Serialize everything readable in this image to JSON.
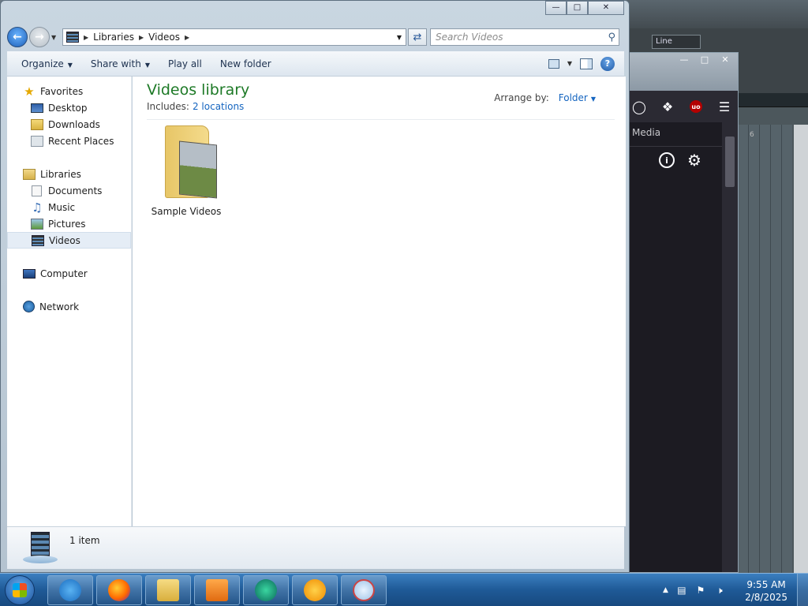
{
  "explorer": {
    "address": {
      "crumbs": [
        "Libraries",
        "Videos"
      ]
    },
    "search": {
      "placeholder": "Search Videos"
    },
    "commands": {
      "organize": "Organize",
      "share_with": "Share with",
      "play_all": "Play all",
      "new_folder": "New folder"
    },
    "nav": {
      "favorites": "Favorites",
      "desktop": "Desktop",
      "downloads": "Downloads",
      "recent_places": "Recent Places",
      "libraries": "Libraries",
      "documents": "Documents",
      "music": "Music",
      "pictures": "Pictures",
      "videos": "Videos",
      "computer": "Computer",
      "network": "Network"
    },
    "library": {
      "title": "Videos library",
      "includes_label": "Includes:",
      "includes_link": "2 locations",
      "arrange_label": "Arrange by:",
      "arrange_value": "Folder"
    },
    "items": [
      {
        "label": "Sample Videos",
        "icon": "folder-icon"
      }
    ],
    "details": {
      "count": "1 item"
    }
  },
  "browser": {
    "sidebar_label": "Media"
  },
  "background_app": {
    "line_select": "Line",
    "cell": "6"
  },
  "taskbar": {
    "clock_time": "9:55 AM",
    "clock_date": "2/8/2025",
    "apps": [
      "internet-explorer-icon",
      "firefox-icon",
      "file-explorer-icon",
      "media-player-icon",
      "circle-app-icon",
      "fl-studio-icon",
      "magnifier-icon"
    ]
  },
  "colors": {
    "title_green": "#1e7a27",
    "link_blue": "#1565c0",
    "taskbar_blue": "#1f5a97"
  }
}
